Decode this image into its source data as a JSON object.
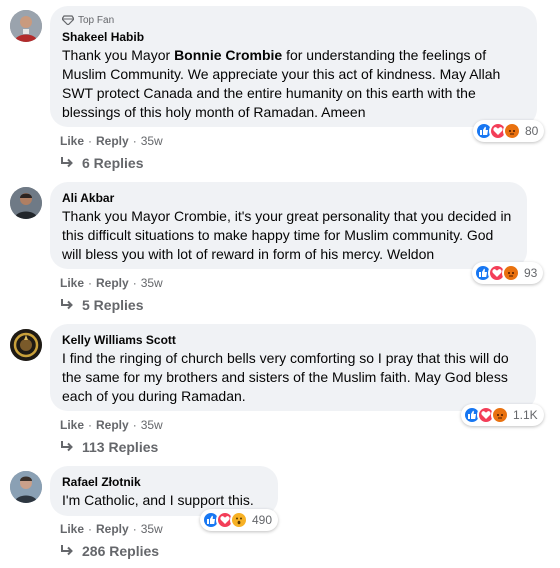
{
  "comments": [
    {
      "badge": "Top Fan",
      "author": "Shakeel Habib",
      "text_before": "Thank you Mayor ",
      "text_bold": "Bonnie Crombie",
      "text_after": " for understanding the feelings of Muslim Community. We appreciate your this act of kindness. May Allah SWT protect Canada and the entire humanity on this earth with the blessings of this holy month of Ramadan. Ameen",
      "like": "Like",
      "reply": "Reply",
      "time": "35w",
      "reactions": [
        "like",
        "love",
        "angry"
      ],
      "reaction_count": "80",
      "replies": "6 Replies"
    },
    {
      "author": "Ali Akbar",
      "text": "Thank you Mayor Crombie, it's your great personality that you decided in this difficult situations to make happy time for Muslim community. God will bless you with lot of reward in form of his mercy. Weldon",
      "like": "Like",
      "reply": "Reply",
      "time": "35w",
      "reactions": [
        "like",
        "love",
        "angry"
      ],
      "reaction_count": "93",
      "replies": "5 Replies"
    },
    {
      "author": "Kelly Williams Scott",
      "text": "I find the ringing of church bells very comforting so I pray that this will do the same for my brothers and sisters of the Muslim faith. May God bless each of you during Ramadan.",
      "like": "Like",
      "reply": "Reply",
      "time": "35w",
      "reactions": [
        "like",
        "love",
        "angry"
      ],
      "reaction_count": "1.1K",
      "replies": "113 Replies"
    },
    {
      "author": "Rafael Złotnik",
      "text": "I'm Catholic, and I support this.",
      "like": "Like",
      "reply": "Reply",
      "time": "35w",
      "reactions": [
        "like",
        "love",
        "wow"
      ],
      "reaction_count": "490",
      "replies": "286 Replies"
    }
  ],
  "colors": {
    "bubble": "#f0f2f5",
    "like": "#1877f2",
    "love": "#f33e58",
    "angry": "#e9710f",
    "wow": "#f7b125",
    "secondary_text": "#65676b"
  }
}
